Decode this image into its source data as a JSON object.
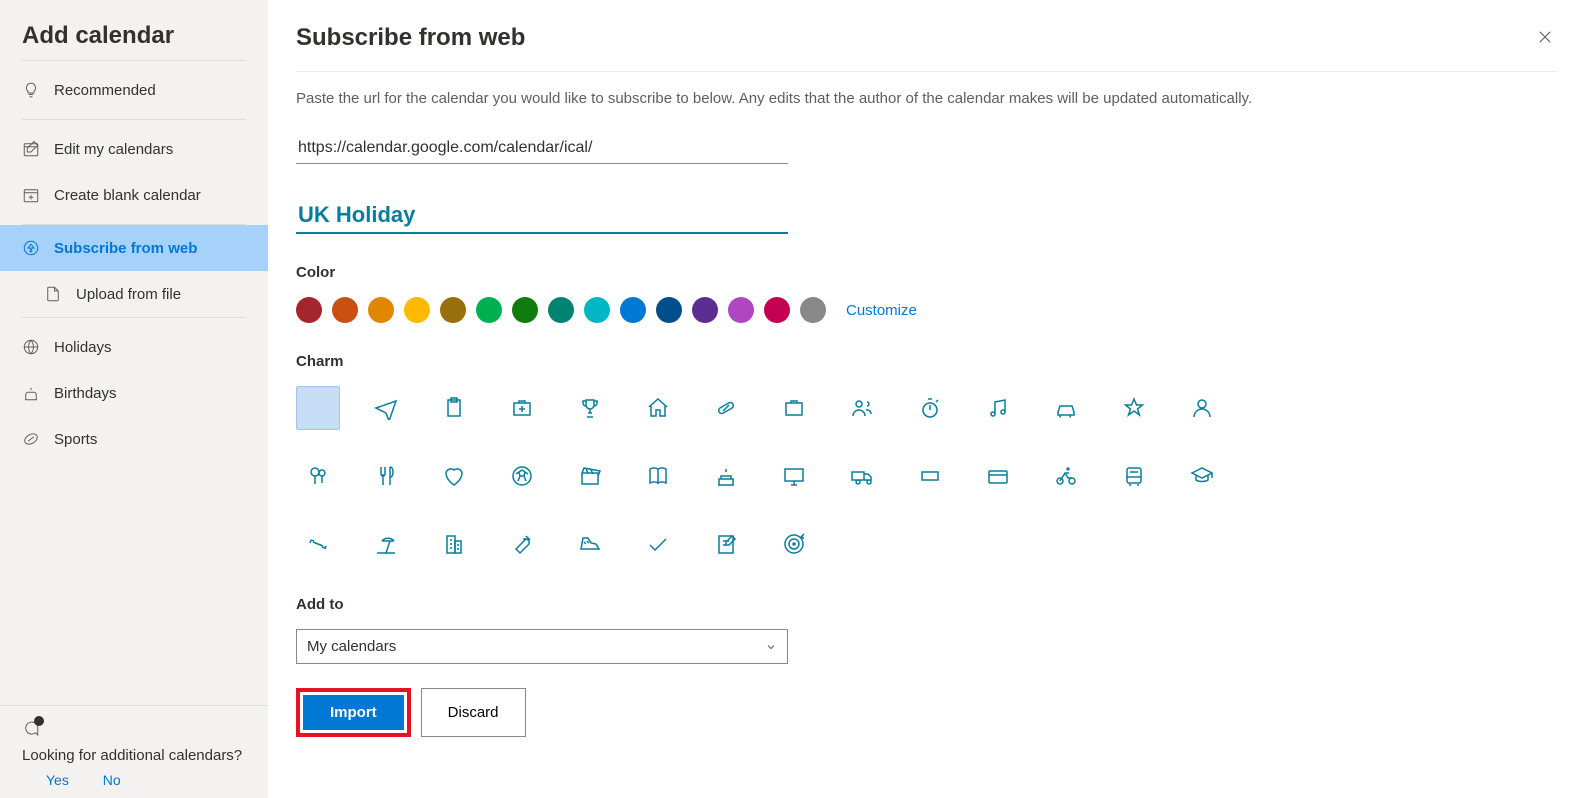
{
  "sidebar": {
    "title": "Add calendar",
    "items": {
      "recommended": "Recommended",
      "edit": "Edit my calendars",
      "create": "Create blank calendar",
      "subscribe": "Subscribe from web",
      "upload": "Upload from file",
      "holidays": "Holidays",
      "birthdays": "Birthdays",
      "sports": "Sports"
    },
    "feedback": {
      "text": "Looking for additional calendars?",
      "yes": "Yes",
      "no": "No"
    }
  },
  "main": {
    "title": "Subscribe from web",
    "description": "Paste the url for the calendar you would like to subscribe to below. Any edits that the author of the calendar makes will be updated automatically.",
    "url_value": "https://calendar.google.com/calendar/ical/",
    "name_value": "UK Holiday",
    "color_label": "Color",
    "customize": "Customize",
    "charm_label": "Charm",
    "addto_label": "Add to",
    "addto_value": "My calendars",
    "import": "Import",
    "discard": "Discard",
    "colors": [
      "#a4262c",
      "#ca5010",
      "#e08700",
      "#ffb900",
      "#986f0b",
      "#00b050",
      "#107c10",
      "#008272",
      "#00b7c3",
      "#0078d4",
      "#004e8c",
      "#5c2e91",
      "#b146c2",
      "#c30052",
      "#8a8886"
    ]
  }
}
